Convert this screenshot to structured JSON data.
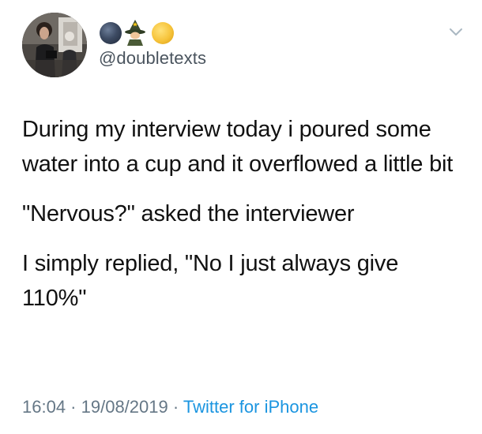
{
  "user": {
    "handle": "@doubletexts",
    "emoji_icons": [
      "new-moon-face-icon",
      "mage-icon",
      "full-moon-icon"
    ]
  },
  "tweet": {
    "paragraphs": [
      "During my interview today i poured some water into a cup and it overflowed a little bit",
      "\"Nervous?\" asked the interviewer",
      "I simply replied, \"No I just always give 110%\""
    ],
    "time": "16:04",
    "separator": " · ",
    "date": "19/08/2019",
    "source": "Twitter for iPhone"
  },
  "colors": {
    "text": "#111111",
    "secondary": "#657786",
    "link": "#1b95e0",
    "background": "#ffffff"
  }
}
